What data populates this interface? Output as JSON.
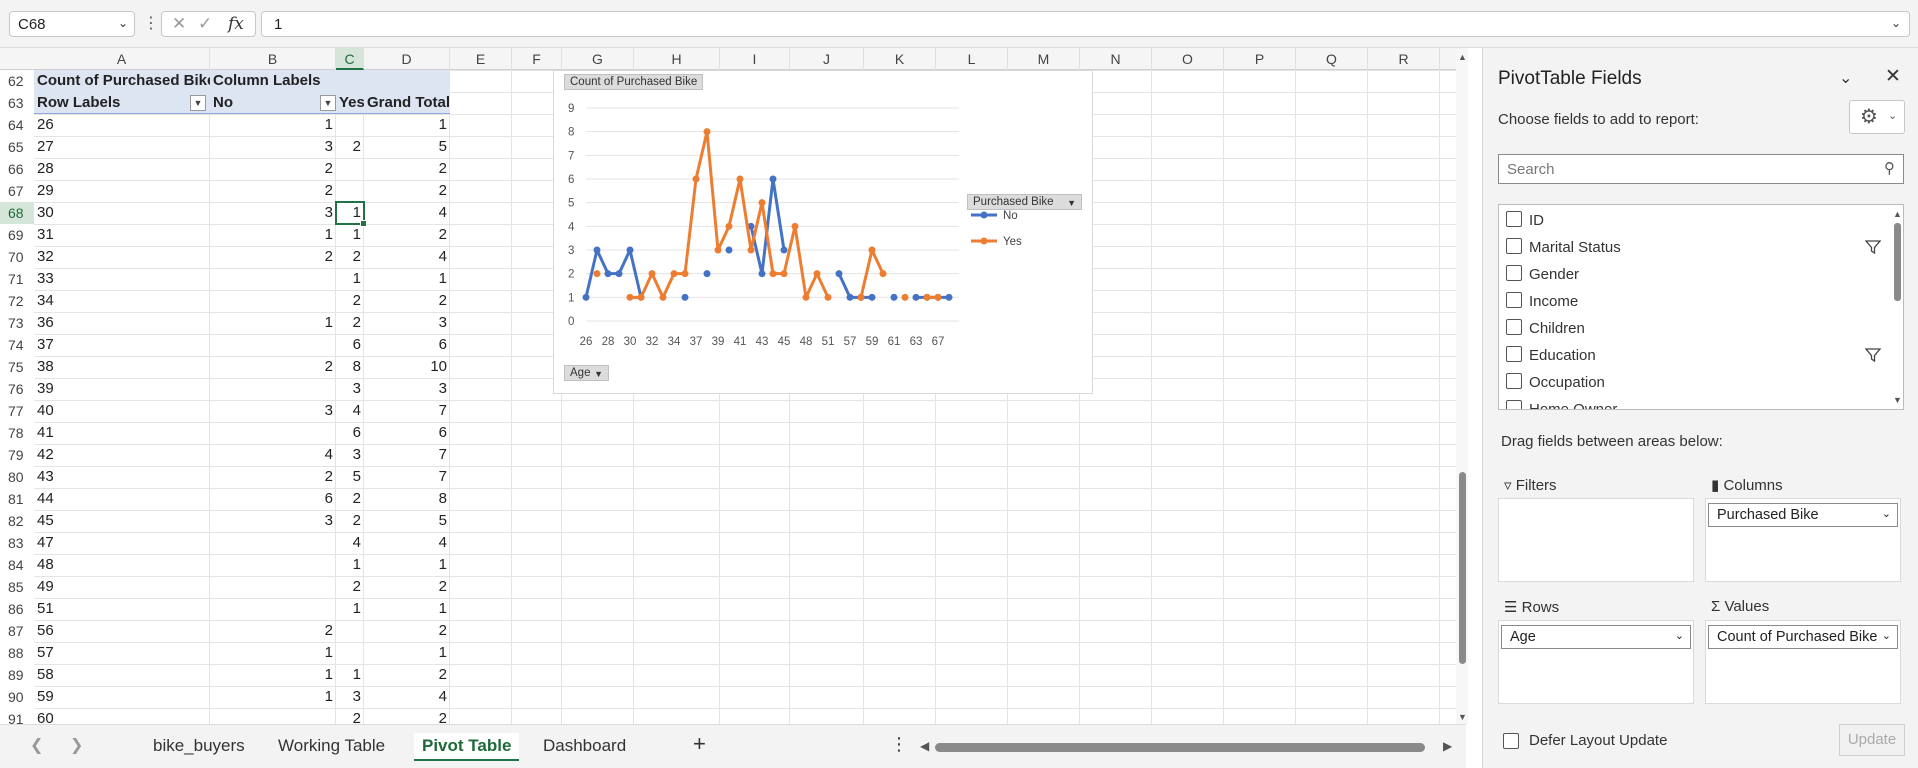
{
  "formula_bar": {
    "name_box": "C68",
    "fx_symbol": "fx",
    "formula": "1"
  },
  "columns": [
    "A",
    "B",
    "C",
    "D",
    "E",
    "F",
    "G",
    "H",
    "I",
    "J",
    "K",
    "L",
    "M",
    "N",
    "O",
    "P",
    "Q",
    "R"
  ],
  "selected_column": "C",
  "selected_row": 68,
  "pivot": {
    "header1": {
      "a": "Count of Purchased Bike",
      "b": "Column Labels"
    },
    "header2": {
      "a": "Row Labels",
      "b": "No",
      "c": "Yes",
      "d": "Grand Total"
    },
    "rows": [
      {
        "n": 64,
        "age": "26",
        "no": "1",
        "yes": "",
        "total": "1"
      },
      {
        "n": 65,
        "age": "27",
        "no": "3",
        "yes": "2",
        "total": "5"
      },
      {
        "n": 66,
        "age": "28",
        "no": "2",
        "yes": "",
        "total": "2"
      },
      {
        "n": 67,
        "age": "29",
        "no": "2",
        "yes": "",
        "total": "2"
      },
      {
        "n": 68,
        "age": "30",
        "no": "3",
        "yes": "1",
        "total": "4"
      },
      {
        "n": 69,
        "age": "31",
        "no": "1",
        "yes": "1",
        "total": "2"
      },
      {
        "n": 70,
        "age": "32",
        "no": "2",
        "yes": "2",
        "total": "4"
      },
      {
        "n": 71,
        "age": "33",
        "no": "",
        "yes": "1",
        "total": "1"
      },
      {
        "n": 72,
        "age": "34",
        "no": "",
        "yes": "2",
        "total": "2"
      },
      {
        "n": 73,
        "age": "36",
        "no": "1",
        "yes": "2",
        "total": "3"
      },
      {
        "n": 74,
        "age": "37",
        "no": "",
        "yes": "6",
        "total": "6"
      },
      {
        "n": 75,
        "age": "38",
        "no": "2",
        "yes": "8",
        "total": "10"
      },
      {
        "n": 76,
        "age": "39",
        "no": "",
        "yes": "3",
        "total": "3"
      },
      {
        "n": 77,
        "age": "40",
        "no": "3",
        "yes": "4",
        "total": "7"
      },
      {
        "n": 78,
        "age": "41",
        "no": "",
        "yes": "6",
        "total": "6"
      },
      {
        "n": 79,
        "age": "42",
        "no": "4",
        "yes": "3",
        "total": "7"
      },
      {
        "n": 80,
        "age": "43",
        "no": "2",
        "yes": "5",
        "total": "7"
      },
      {
        "n": 81,
        "age": "44",
        "no": "6",
        "yes": "2",
        "total": "8"
      },
      {
        "n": 82,
        "age": "45",
        "no": "3",
        "yes": "2",
        "total": "5"
      },
      {
        "n": 83,
        "age": "47",
        "no": "",
        "yes": "4",
        "total": "4"
      },
      {
        "n": 84,
        "age": "48",
        "no": "",
        "yes": "1",
        "total": "1"
      },
      {
        "n": 85,
        "age": "49",
        "no": "",
        "yes": "2",
        "total": "2"
      },
      {
        "n": 86,
        "age": "51",
        "no": "",
        "yes": "1",
        "total": "1"
      },
      {
        "n": 87,
        "age": "56",
        "no": "2",
        "yes": "",
        "total": "2"
      },
      {
        "n": 88,
        "age": "57",
        "no": "1",
        "yes": "",
        "total": "1"
      },
      {
        "n": 89,
        "age": "58",
        "no": "1",
        "yes": "1",
        "total": "2"
      },
      {
        "n": 90,
        "age": "59",
        "no": "1",
        "yes": "3",
        "total": "4"
      },
      {
        "n": 91,
        "age": "60",
        "no": "",
        "yes": "2",
        "total": "2"
      }
    ]
  },
  "chart_data": {
    "type": "line",
    "field_buttons": {
      "values": "Count of Purchased Bike",
      "legend": "Purchased Bike",
      "axis": "Age"
    },
    "x_tick_labels": [
      "26",
      "28",
      "30",
      "32",
      "34",
      "37",
      "39",
      "41",
      "43",
      "45",
      "48",
      "51",
      "57",
      "59",
      "61",
      "63",
      "67"
    ],
    "y_tick_labels": [
      "0",
      "1",
      "2",
      "3",
      "4",
      "5",
      "6",
      "7",
      "8",
      "9"
    ],
    "ylim": [
      0,
      9
    ],
    "legend_position": "right",
    "series": [
      {
        "name": "No",
        "color": "#4472c4",
        "values": [
          1,
          3,
          2,
          2,
          3,
          1,
          null,
          null,
          null,
          1,
          null,
          2,
          null,
          3,
          null,
          4,
          2,
          6,
          3,
          null,
          null,
          null,
          null,
          2,
          1,
          1,
          1,
          null,
          1,
          null,
          1,
          1,
          1,
          1
        ]
      },
      {
        "name": "Yes",
        "color": "#ed7d31",
        "values": [
          null,
          2,
          null,
          null,
          1,
          1,
          2,
          1,
          2,
          2,
          6,
          8,
          3,
          4,
          6,
          3,
          5,
          2,
          2,
          4,
          1,
          2,
          1,
          null,
          null,
          1,
          3,
          2,
          null,
          1,
          null,
          1,
          1,
          null
        ]
      }
    ]
  },
  "sheet_tabs": {
    "tabs": [
      "bike_buyers",
      "Working Table",
      "Pivot Table",
      "Dashboard"
    ],
    "active": "Pivot Table",
    "add_symbol": "+",
    "more_symbol": "⋮"
  },
  "pane": {
    "title": "PivotTable Fields",
    "subtitle": "Choose fields to add to report:",
    "search_placeholder": "Search",
    "fields": [
      {
        "label": "ID",
        "filtered": false
      },
      {
        "label": "Marital Status",
        "filtered": true
      },
      {
        "label": "Gender",
        "filtered": false
      },
      {
        "label": "Income",
        "filtered": false
      },
      {
        "label": "Children",
        "filtered": false
      },
      {
        "label": "Education",
        "filtered": true
      },
      {
        "label": "Occupation",
        "filtered": false
      },
      {
        "label": "Home Owner",
        "filtered": false
      }
    ],
    "drag_label": "Drag fields between areas below:",
    "areas": {
      "filters": {
        "label": "Filters",
        "items": []
      },
      "columns": {
        "label": "Columns",
        "items": [
          "Purchased Bike"
        ]
      },
      "rows": {
        "label": "Rows",
        "items": [
          "Age"
        ]
      },
      "values": {
        "label": "Values",
        "items": [
          "Count of Purchased Bike"
        ]
      }
    },
    "defer_label": "Defer Layout Update",
    "update_label": "Update"
  }
}
